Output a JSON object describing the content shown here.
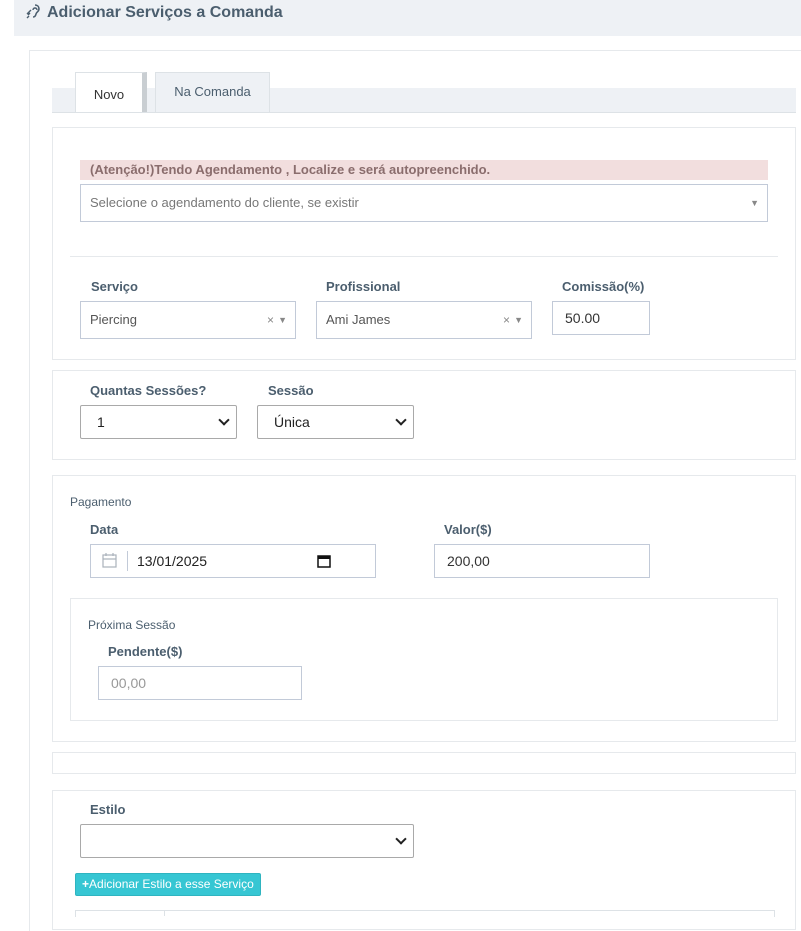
{
  "header": {
    "title": "Adicionar Serviços a Comanda",
    "icon": "assistive-listening-icon"
  },
  "tabs": [
    {
      "label": "Novo",
      "active": true
    },
    {
      "label": "Na Comanda",
      "active": false
    }
  ],
  "scheduling": {
    "alert": "(Atenção!)Tendo Agendamento , Localize e será autopreenchido.",
    "placeholder": "Selecione o agendamento do cliente, se existir"
  },
  "service": {
    "servico_label": "Serviço",
    "servico_value": "Piercing",
    "profissional_label": "Profissional",
    "profissional_value": "Ami James",
    "comissao_label": "Comissão(%)",
    "comissao_value": "50.00"
  },
  "sessions": {
    "quantas_label": "Quantas Sessões?",
    "quantas_value": "1",
    "sessao_label": "Sessão",
    "sessao_value": "Única"
  },
  "payment": {
    "section_label": "Pagamento",
    "data_label": "Data",
    "data_value": "13/01/2025",
    "valor_label": "Valor($)",
    "valor_value": "200,00",
    "proxima_label": "Próxima Sessão",
    "pendente_label": "Pendente($)",
    "pendente_placeholder": "00,00"
  },
  "style": {
    "label": "Estilo",
    "value": "",
    "add_button": "Adicionar Estilo a esse Serviço"
  },
  "colors": {
    "accent": "#36c6d3",
    "alert_bg": "#f2dede",
    "label": "#4b5e6e"
  }
}
